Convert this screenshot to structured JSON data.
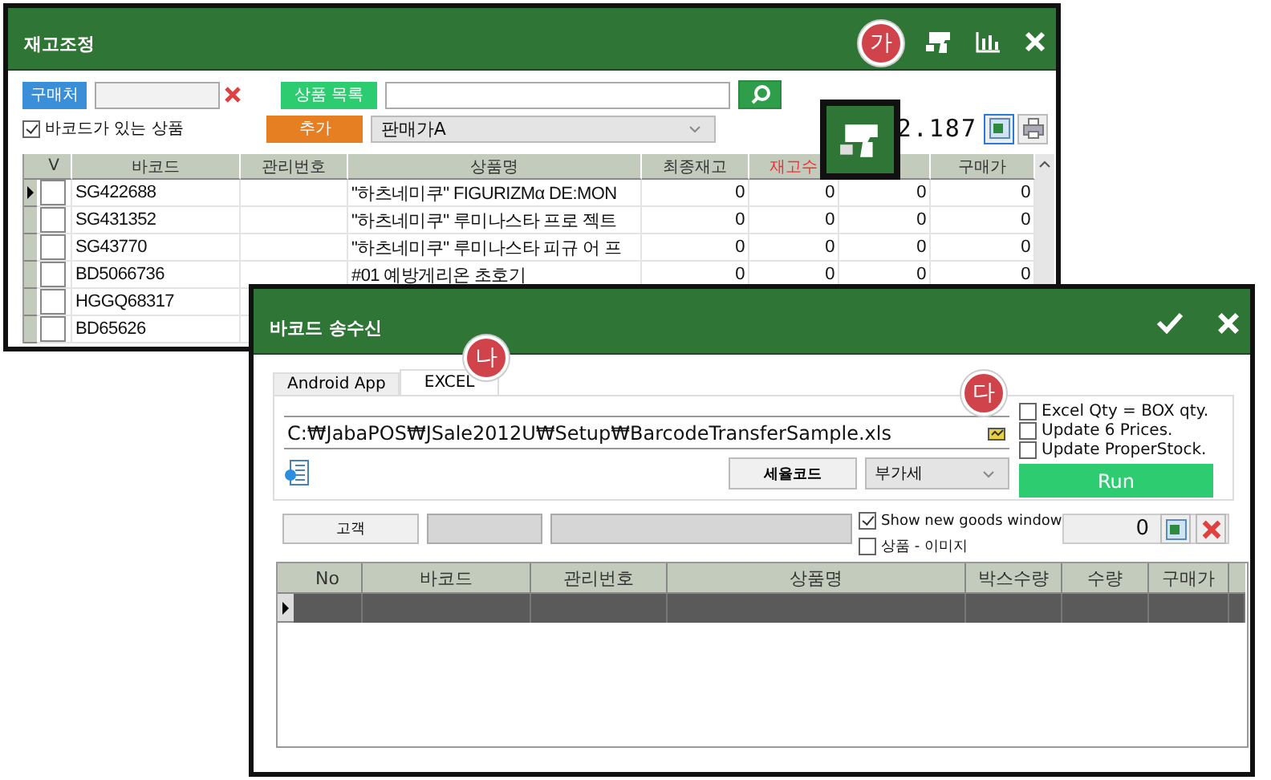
{
  "back_window": {
    "title": "재고조정",
    "supplier_button": "구매처",
    "product_list_button": "상품 목록",
    "add_button": "추가",
    "barcode_only": {
      "label": "바코드가 있는 상품",
      "checked": true
    },
    "price_select": {
      "value": "판매가A"
    },
    "total": "2.187",
    "table": {
      "columns": [
        {
          "label": "V",
          "kind": "normal"
        },
        {
          "label": "바코드",
          "kind": "normal"
        },
        {
          "label": "관리번호",
          "kind": "normal"
        },
        {
          "label": "상품명",
          "kind": "normal"
        },
        {
          "label": "최종재고",
          "kind": "normal"
        },
        {
          "label": "재고수",
          "kind": "alert"
        },
        {
          "kind": "covered"
        },
        {
          "label": "구매가",
          "kind": "normal"
        }
      ],
      "rows": [
        {
          "selected": true,
          "checked": false,
          "barcode": "SG422688",
          "product_name": "\"하츠네미쿠\" FIGURIZMα DE:MON",
          "final_stock": "0",
          "stock_qty": "0",
          "column_7": "0",
          "purchase_price": "0"
        },
        {
          "selected": false,
          "checked": false,
          "barcode": "SG431352",
          "product_name": "\"하츠네미쿠\" 루미나스타 프로 젝트",
          "final_stock": "0",
          "stock_qty": "0",
          "column_7": "0",
          "purchase_price": "0"
        },
        {
          "selected": false,
          "checked": false,
          "barcode": "SG43770",
          "product_name": "\"하츠네미쿠\" 루미나스타 피규 어 프",
          "final_stock": "0",
          "stock_qty": "0",
          "column_7": "0",
          "purchase_price": "0"
        },
        {
          "selected": false,
          "checked": false,
          "barcode": "BD5066736",
          "product_name": "#01 예방게리온 초호기",
          "final_stock": "0",
          "stock_qty": "0",
          "column_7": "0",
          "purchase_price": "0"
        },
        {
          "selected": false,
          "checked": false,
          "barcode": "HGGQ68317"
        },
        {
          "selected": false,
          "checked": false,
          "barcode": "BD65626"
        }
      ]
    }
  },
  "front_window": {
    "title": "바코드 송수신",
    "tabs": [
      {
        "label": "Android App",
        "selected": false
      },
      {
        "label": "EXCEL",
        "selected": true
      }
    ],
    "file_path": "C:₩JabaPOS₩JSale2012U₩Setup₩BarcodeTransferSample.xls",
    "tax_code_button": "세율코드",
    "tax_select": {
      "value": "부가세"
    },
    "options": [
      {
        "label": "Excel Qty = BOX qty.",
        "checked": false
      },
      {
        "label": "Update 6 Prices.",
        "checked": false
      },
      {
        "label": "Update ProperStock.",
        "checked": false
      }
    ],
    "run_button": "Run",
    "customer_button": "고객",
    "show_options": [
      {
        "label": "Show new goods window",
        "checked": true
      },
      {
        "label": "상품 - 이미지",
        "checked": false
      }
    ],
    "count": "0",
    "table": {
      "columns": [
        "No",
        "바코드",
        "관리번호",
        "상품명",
        "박스수량",
        "수량",
        "구매가"
      ],
      "rows": [
        {
          "selected": true
        }
      ]
    }
  },
  "callouts": [
    {
      "label": "가"
    },
    {
      "label": "나"
    },
    {
      "label": "다"
    }
  ]
}
